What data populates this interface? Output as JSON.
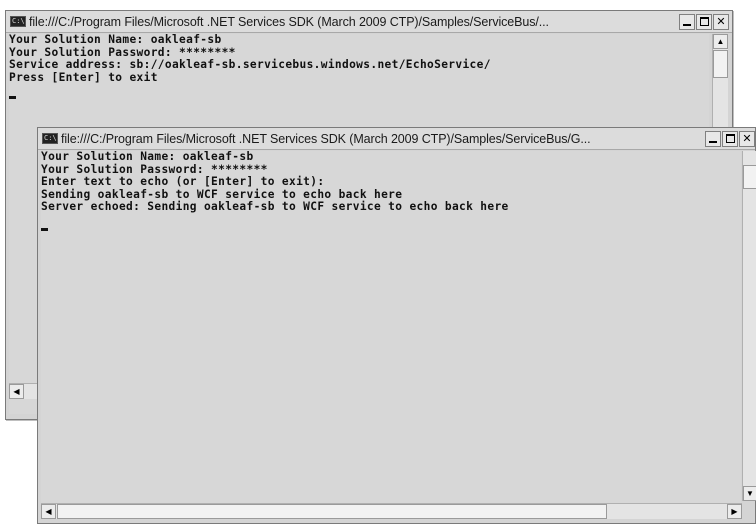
{
  "window_back": {
    "title": "file:///C:/Program Files/Microsoft .NET Services SDK (March 2009 CTP)/Samples/ServiceBus/...",
    "lines": [
      "Your Solution Name: oakleaf-sb",
      "Your Solution Password: ********",
      "Service address: sb://oakleaf-sb.servicebus.windows.net/EchoService/",
      "Press [Enter] to exit"
    ]
  },
  "window_front": {
    "title": "file:///C:/Program Files/Microsoft .NET Services SDK (March 2009 CTP)/Samples/ServiceBus/G...",
    "lines": [
      "Your Solution Name: oakleaf-sb",
      "Your Solution Password: ********",
      "Enter text to echo (or [Enter] to exit):",
      "Sending oakleaf-sb to WCF service to echo back here",
      "Server echoed: Sending oakleaf-sb to WCF service to echo back here"
    ]
  },
  "icons": {
    "app": "console-icon",
    "minimize": "minimize-icon",
    "maximize": "maximize-icon",
    "close": "close-icon",
    "close_glyph": "✕",
    "up": "▲",
    "down": "▼",
    "left": "◀",
    "right": "▶",
    "app_text": "C:\\"
  }
}
